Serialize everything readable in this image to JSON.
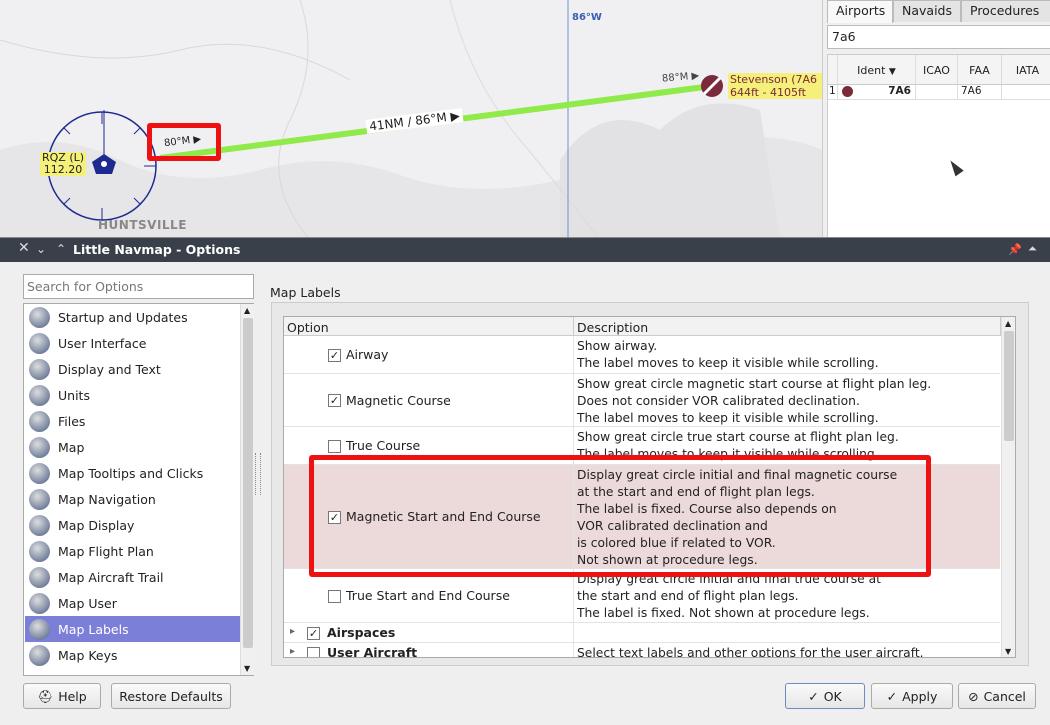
{
  "map": {
    "meridian_label": "86°W",
    "vor_ident": "RQZ (L)",
    "vor_freq": "112.20",
    "city": "HUNTSVILLE",
    "start_course": "80°M",
    "leg_label": "41NM / 86°M",
    "end_course": "88°M",
    "airport_name": "Stevenson (7A6",
    "airport_elev": "644ft - 4105ft"
  },
  "search_panel": {
    "tabs": [
      "Airports",
      "Navaids",
      "Procedures"
    ],
    "search_value": "7a6",
    "columns": [
      "Ident",
      "ICAO",
      "FAA",
      "IATA"
    ],
    "row": {
      "num": "1",
      "ident": "7A6",
      "icao": "",
      "faa": "7A6",
      "iata": ""
    }
  },
  "dialog": {
    "title": "Little Navmap - Options",
    "search_placeholder": "Search for Options",
    "section_title": "Map Labels",
    "categories": [
      "Startup and Updates",
      "User Interface",
      "Display and Text",
      "Units",
      "Files",
      "Map",
      "Map Tooltips and Clicks",
      "Map Navigation",
      "Map Display",
      "Map Flight Plan",
      "Map Aircraft Trail",
      "Map User",
      "Map Labels",
      "Map Keys"
    ],
    "selected_category": "Map Labels",
    "tree_columns": {
      "option": "Option",
      "description": "Description"
    },
    "rows": [
      {
        "label": "Airway",
        "checked": true,
        "desc": "Show airway.\nThe label moves to keep it visible while scrolling."
      },
      {
        "label": "Magnetic Course",
        "checked": true,
        "desc": "Show great circle magnetic start course at flight plan leg.\nDoes not consider VOR calibrated declination.\nThe label moves to keep it visible while scrolling."
      },
      {
        "label": "True Course",
        "checked": false,
        "desc": "Show great circle true start course at flight plan leg.\nThe label moves to keep it visible while scrolling."
      },
      {
        "label": "Magnetic Start and End Course",
        "checked": true,
        "desc": "Display great circle initial and final magnetic course\nat the start and end of flight plan legs.\nThe label is fixed. Course also depends on\nVOR calibrated declination and\nis colored blue if related to VOR.\nNot shown at procedure legs."
      },
      {
        "label": "True Start and End Course",
        "checked": false,
        "desc": "Display great circle initial and final true course at\nthe start and end of flight plan legs.\nThe label is fixed. Not shown at procedure legs."
      },
      {
        "label": "Airspaces",
        "checked": true,
        "desc": ""
      },
      {
        "label": "User Aircraft",
        "checked": false,
        "desc": "Select text labels and other options for the user aircraft."
      }
    ],
    "buttons": {
      "help": "Help",
      "restore": "Restore Defaults",
      "ok": "OK",
      "apply": "Apply",
      "cancel": "Cancel"
    }
  },
  "colors": {
    "highlight": "#ee1111",
    "route": "#8fea4a",
    "selection": "#7c7fd8",
    "titlebar": "#3a4049"
  }
}
